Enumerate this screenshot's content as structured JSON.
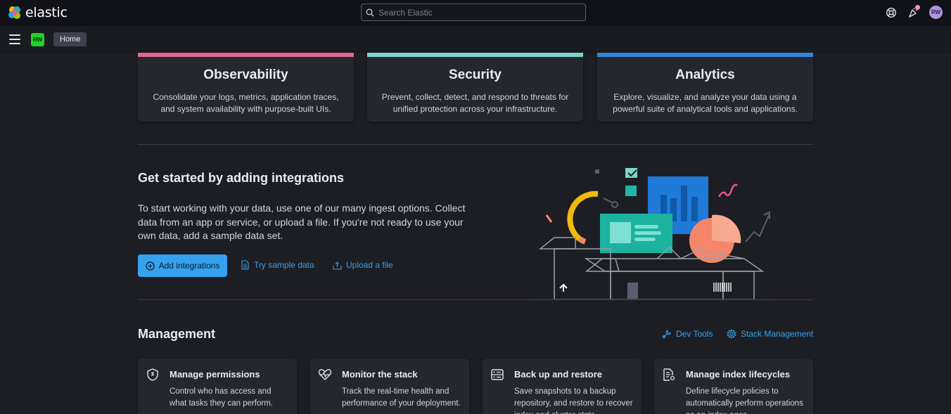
{
  "header": {
    "brand": "elastic",
    "search_placeholder": "Search Elastic",
    "user_initials": "RW"
  },
  "subheader": {
    "space_initials": "RW",
    "breadcrumb": "Home"
  },
  "solutions": [
    {
      "title": "Observability",
      "description": "Consolidate your logs, metrics, application traces, and system availability with purpose-built UIs.",
      "color": "#e0668f"
    },
    {
      "title": "Security",
      "description": "Prevent, collect, detect, and respond to threats for unified protection across your infrastructure.",
      "color": "#7dd5c9"
    },
    {
      "title": "Analytics",
      "description": "Explore, visualize, and analyze your data using a powerful suite of analytical tools and applications.",
      "color": "#2f86d9"
    }
  ],
  "integrations": {
    "title": "Get started by adding integrations",
    "description": "To start working with your data, use one of our many ingest options. Collect data from an app or service, or upload a file. If you're not ready to use your own data, add a sample data set.",
    "add_button": "Add integrations",
    "sample_link": "Try sample data",
    "upload_link": "Upload a file"
  },
  "management": {
    "title": "Management",
    "dev_tools": "Dev Tools",
    "stack_management": "Stack Management",
    "cards": [
      {
        "title": "Manage permissions",
        "description": "Control who has access and what tasks they can perform.",
        "icon": "shield-icon"
      },
      {
        "title": "Monitor the stack",
        "description": "Track the real-time health and performance of your deployment.",
        "icon": "heartbeat-icon"
      },
      {
        "title": "Back up and restore",
        "description": "Save snapshots to a backup repository, and restore to recover index and cluster state.",
        "icon": "server-icon"
      },
      {
        "title": "Manage index lifecycles",
        "description": "Define lifecycle policies to automatically perform operations as an index ages.",
        "icon": "document-gear-icon"
      }
    ]
  }
}
